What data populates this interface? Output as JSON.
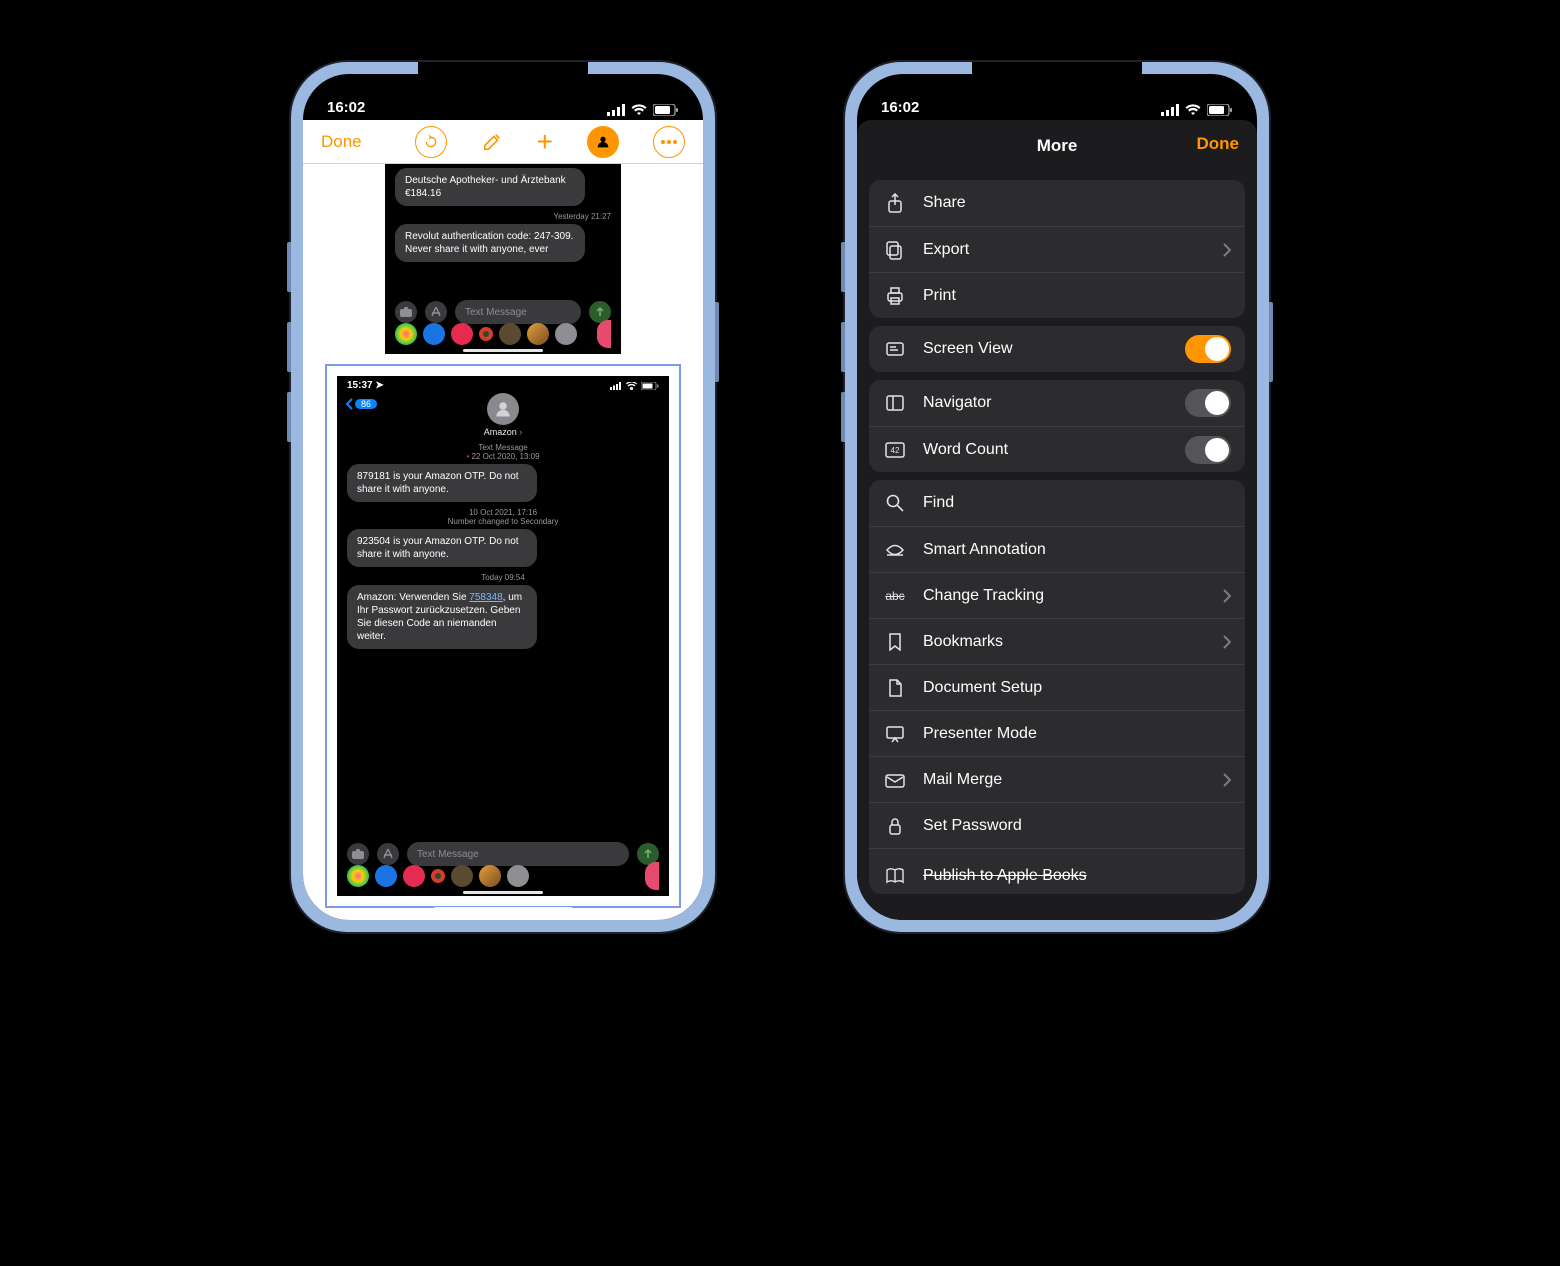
{
  "status": {
    "time": "16:02"
  },
  "left": {
    "done": "Done",
    "shot_top": {
      "msg1": "Deutsche Apotheker- und Ärztebank €184.16",
      "time1": "Yesterday 21:27",
      "msg2": "Revolut authentication code: 247-309. Never share it with anyone, ever",
      "compose_placeholder": "Text Message"
    },
    "shot_main": {
      "time": "15:37",
      "back_count": "86",
      "contact": "Amazon",
      "h1a": "Text Message",
      "h1b": "22 Oct 2020, 13:09",
      "m1": "879181 is your Amazon OTP. Do not share it with anyone.",
      "h2": "10 Oct 2021, 17:16",
      "h2b": "Number changed to Secondary",
      "m2": "923504 is your Amazon OTP. Do not share it with anyone.",
      "h3": "Today 09:54",
      "m3_pre": "Amazon: Verwenden Sie ",
      "m3_link": "758348",
      "m3_post": ", um Ihr Passwort zurückzusetzen. Geben Sie diesen Code an niemanden weiter.",
      "compose_placeholder": "Text Message"
    }
  },
  "right": {
    "title": "More",
    "done": "Done",
    "share": "Share",
    "export": "Export",
    "print": "Print",
    "screen_view": "Screen View",
    "navigator": "Navigator",
    "word_count": "Word Count",
    "find": "Find",
    "smart_annotation": "Smart Annotation",
    "change_tracking": "Change Tracking",
    "bookmarks": "Bookmarks",
    "document_setup": "Document Setup",
    "presenter_mode": "Presenter Mode",
    "mail_merge": "Mail Merge",
    "set_password": "Set Password",
    "publish": "Publish to Apple Books"
  }
}
